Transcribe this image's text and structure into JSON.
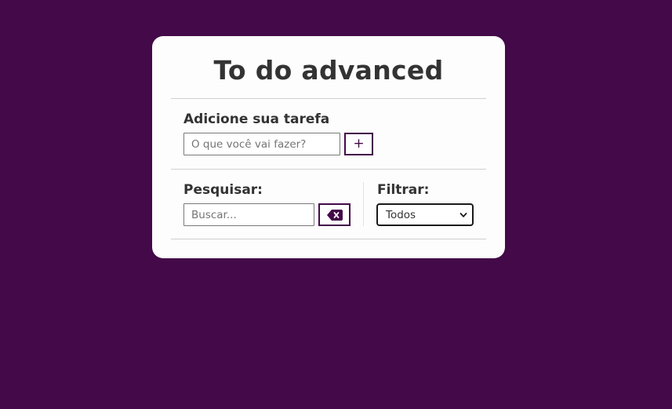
{
  "app": {
    "title": "To do advanced"
  },
  "add_section": {
    "label": "Adicione sua tarefa",
    "input_placeholder": "O que você vai fazer?",
    "input_value": "",
    "add_button_label": "+",
    "add_button_icon": "plus-icon"
  },
  "search_section": {
    "label": "Pesquisar:",
    "input_placeholder": "Buscar...",
    "input_value": "",
    "clear_button_icon": "backspace-icon"
  },
  "filter_section": {
    "label": "Filtrar:",
    "selected": "Todos",
    "chevron_icon": "chevron-down-icon"
  },
  "colors": {
    "background": "#430948",
    "card": "#fdfdfd",
    "accent": "#430948",
    "text": "#333333"
  }
}
